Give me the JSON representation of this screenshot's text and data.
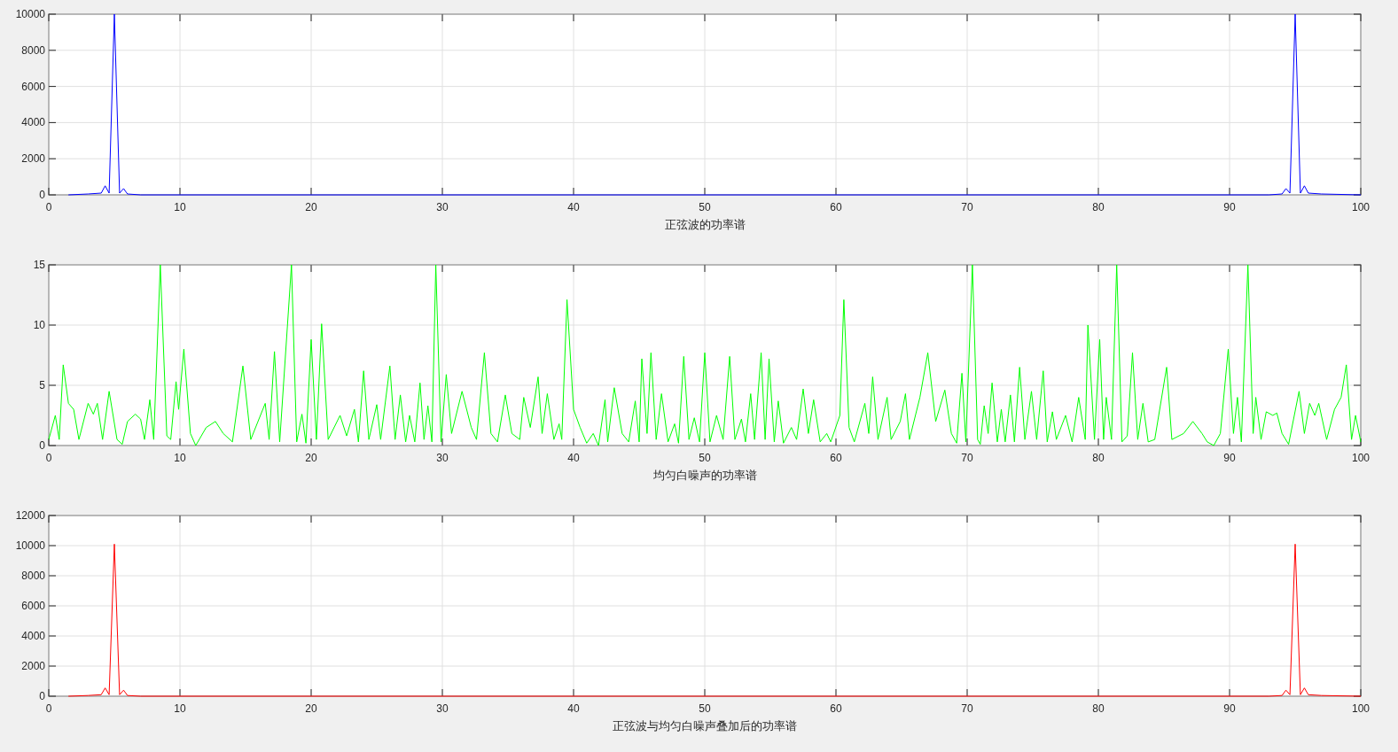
{
  "figure": {
    "axes": [
      {
        "chart_data": {
          "type": "line",
          "xlabel": "正弦波的功率谱",
          "xlim": [
            0,
            100
          ],
          "ylim": [
            0,
            10000
          ],
          "xticks": [
            0,
            10,
            20,
            30,
            40,
            50,
            60,
            70,
            80,
            90,
            100
          ],
          "yticks": [
            0,
            2000,
            4000,
            6000,
            8000,
            10000
          ],
          "x": [
            1.5,
            3,
            4,
            4.3,
            4.6,
            5,
            5.4,
            5.7,
            6,
            7,
            93,
            94,
            94.3,
            94.6,
            95,
            95.4,
            95.7,
            96,
            97,
            100
          ],
          "grid": true,
          "series": [
            {
              "color": "#0000ff",
              "values": [
                0,
                50,
                100,
                500,
                100,
                10000,
                100,
                350,
                50,
                0,
                0,
                50,
                350,
                100,
                10000,
                100,
                500,
                100,
                50,
                0
              ]
            }
          ]
        }
      },
      {
        "chart_data": {
          "type": "line",
          "xlabel": "均匀白噪声的功率谱",
          "xlim": [
            0,
            100
          ],
          "ylim": [
            0,
            15
          ],
          "xticks": [
            0,
            10,
            20,
            30,
            40,
            50,
            60,
            70,
            80,
            90,
            100
          ],
          "yticks": [
            0,
            5,
            10,
            15
          ],
          "x": [
            0,
            0.5,
            0.8,
            1.1,
            1.5,
            1.9,
            2.3,
            3,
            3.4,
            3.7,
            4.1,
            4.6,
            5.2,
            5.6,
            6,
            6.6,
            7,
            7.3,
            7.7,
            8,
            8.5,
            9,
            9.3,
            9.7,
            9.9,
            10.3,
            10.8,
            11.2,
            12,
            12.7,
            13.3,
            14,
            14.8,
            15.4,
            16.5,
            16.8,
            17.2,
            17.6,
            18.5,
            18.9,
            19.3,
            19.6,
            20,
            20.4,
            20.8,
            21.3,
            22.2,
            22.7,
            23.3,
            23.6,
            24,
            24.4,
            25,
            25.3,
            26,
            26.4,
            26.8,
            27.2,
            27.5,
            27.9,
            28.3,
            28.6,
            28.9,
            29.2,
            29.5,
            29.9,
            30.3,
            30.7,
            31.5,
            32.2,
            32.6,
            33.2,
            33.7,
            34.2,
            34.8,
            35.3,
            35.9,
            36.2,
            36.7,
            37.3,
            37.6,
            38,
            38.5,
            38.9,
            39.1,
            39.5,
            40,
            40.5,
            41,
            41.5,
            41.9,
            42.4,
            42.6,
            43.1,
            43.7,
            44.2,
            44.7,
            45,
            45.2,
            45.6,
            45.9,
            46.3,
            46.7,
            47.2,
            47.7,
            48,
            48.4,
            48.8,
            49.2,
            49.6,
            50,
            50.4,
            50.9,
            51.4,
            51.9,
            52.3,
            52.8,
            53.1,
            53.5,
            53.8,
            54.3,
            54.6,
            54.9,
            55.3,
            55.6,
            56,
            56.6,
            57,
            57.5,
            57.9,
            58.3,
            58.8,
            59.3,
            59.6,
            60.3,
            60.6,
            61,
            61.4,
            62.2,
            62.5,
            62.8,
            63.2,
            63.9,
            64.2,
            64.9,
            65.3,
            65.6,
            66.4,
            67,
            67.6,
            68.3,
            68.8,
            69.2,
            69.6,
            69.9,
            70.4,
            70.8,
            71,
            71.3,
            71.6,
            71.9,
            72.3,
            72.6,
            72.9,
            73.3,
            73.6,
            74,
            74.4,
            74.9,
            75.3,
            75.8,
            76.1,
            76.5,
            76.8,
            77.5,
            78,
            78.5,
            79,
            79.2,
            79.7,
            80.1,
            80.4,
            80.6,
            81,
            81.4,
            81.8,
            82.2,
            82.6,
            83,
            83.4,
            83.8,
            84.3,
            85.2,
            85.6,
            86.5,
            87.2,
            87.9,
            88.3,
            88.8,
            89.3,
            89.9,
            90.3,
            90.6,
            90.9,
            91.4,
            91.8,
            92,
            92.4,
            92.8,
            93.3,
            93.6,
            94,
            94.5,
            95.3,
            95.7,
            96.1,
            96.5,
            96.8,
            97.4,
            98,
            98.5,
            98.9,
            99.3,
            99.6,
            100
          ],
          "grid": true,
          "series": [
            {
              "color": "#00ff00",
              "values": [
                0.5,
                2.5,
                0.5,
                6.7,
                3.5,
                3,
                0.5,
                3.5,
                2.6,
                3.5,
                0.5,
                4.5,
                0.5,
                0.1,
                2,
                2.6,
                2.2,
                0.5,
                3.8,
                0.5,
                15,
                0.8,
                0.5,
                5.3,
                3,
                8,
                1,
                0,
                1.5,
                2,
                1,
                0.3,
                6.6,
                0.5,
                3.5,
                0.5,
                7.8,
                0.3,
                15,
                0.3,
                2.6,
                0.2,
                8.8,
                0.5,
                10.1,
                0.5,
                2.5,
                0.8,
                3,
                0.3,
                6.2,
                0.5,
                3.4,
                0.5,
                6.6,
                0.5,
                4.2,
                0.3,
                2.5,
                0.3,
                5.2,
                0.5,
                3.3,
                0.3,
                15,
                0.3,
                5.9,
                1,
                4.5,
                1.5,
                0.5,
                7.7,
                1,
                0.3,
                4.2,
                1,
                0.5,
                4,
                1.5,
                5.7,
                1,
                4.3,
                0.5,
                1.8,
                0.5,
                12.1,
                3,
                1.5,
                0.2,
                1,
                0,
                3.8,
                0.3,
                4.8,
                1,
                0.3,
                3.7,
                0.3,
                7.2,
                1,
                7.7,
                0.5,
                4.3,
                0.3,
                1.8,
                0.2,
                7.4,
                0.5,
                2.3,
                0.3,
                7.7,
                0.3,
                2.5,
                0.5,
                7.4,
                0.5,
                2.2,
                0.3,
                4.3,
                0.5,
                7.7,
                0.5,
                7.2,
                0.3,
                3.7,
                0.2,
                1.5,
                0.5,
                4.7,
                1,
                3.8,
                0.3,
                1,
                0.3,
                2.5,
                12.1,
                1.5,
                0.3,
                3.5,
                1,
                5.7,
                0.5,
                4,
                0.5,
                2,
                4.3,
                0.5,
                4,
                7.7,
                2,
                4.6,
                1,
                0.2,
                6,
                0.3,
                15,
                0.5,
                0.1,
                3.3,
                1,
                5.2,
                0.3,
                3,
                0.3,
                4.2,
                0.3,
                6.5,
                0.5,
                4.5,
                0.5,
                6.2,
                0.3,
                2.8,
                0.5,
                2.5,
                0.3,
                4,
                0.5,
                10,
                0.5,
                8.8,
                0.5,
                4,
                0.5,
                15,
                0.3,
                0.8,
                7.7,
                0.5,
                3.5,
                0.3,
                0.5,
                6.5,
                0.5,
                1,
                2,
                1,
                0.3,
                0,
                1,
                8,
                1,
                4,
                0.3,
                15,
                1,
                4,
                0.5,
                2.8,
                2.5,
                2.7,
                1,
                0.1,
                4.5,
                1,
                3.5,
                2.5,
                3.5,
                0.5,
                3,
                4,
                6.7,
                0.5,
                2.5,
                0.3
              ]
            }
          ]
        }
      },
      {
        "chart_data": {
          "type": "line",
          "xlabel": "正弦波与均匀白噪声叠加后的功率谱",
          "xlim": [
            0,
            100
          ],
          "ylim": [
            0,
            12000
          ],
          "xticks": [
            0,
            10,
            20,
            30,
            40,
            50,
            60,
            70,
            80,
            90,
            100
          ],
          "yticks": [
            0,
            2000,
            4000,
            6000,
            8000,
            10000,
            12000
          ],
          "x": [
            1.5,
            3,
            4,
            4.3,
            4.6,
            5,
            5.4,
            5.7,
            6,
            7,
            93,
            94,
            94.3,
            94.6,
            95,
            95.4,
            95.7,
            96,
            97,
            100
          ],
          "grid": true,
          "series": [
            {
              "color": "#ff0000",
              "values": [
                0,
                50,
                100,
                550,
                100,
                10100,
                100,
                400,
                50,
                0,
                0,
                50,
                400,
                100,
                10100,
                100,
                550,
                100,
                50,
                0
              ]
            }
          ]
        }
      }
    ]
  }
}
